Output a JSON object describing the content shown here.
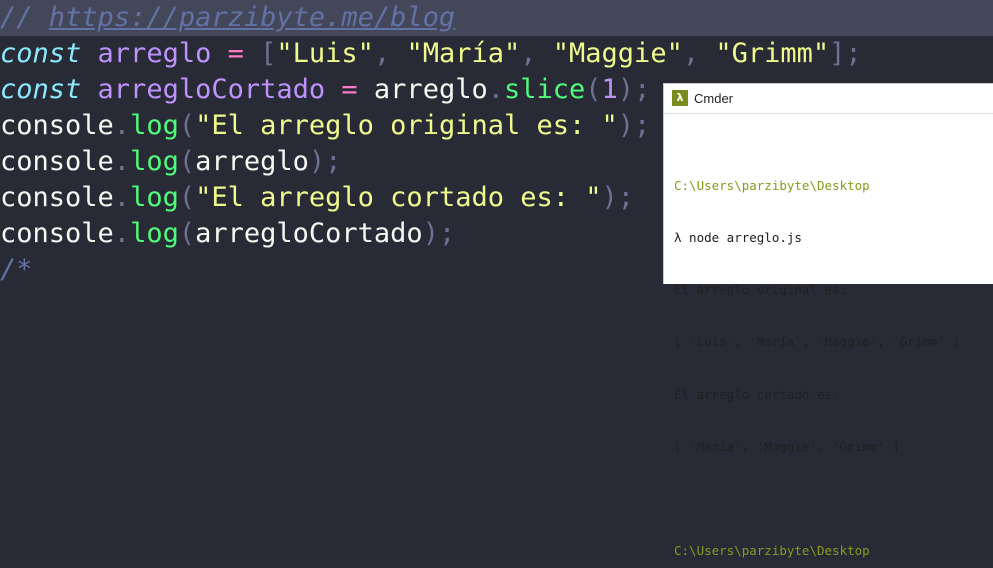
{
  "editor": {
    "comment": {
      "slashes": "// ",
      "url": "https://parzibyte.me/blog"
    },
    "line2": {
      "kw": "const",
      "name": "arreglo",
      "eq": "=",
      "open": "[",
      "s1": "\"Luis\"",
      "c1": ", ",
      "s2": "\"María\"",
      "c2": ", ",
      "s3": "\"Maggie\"",
      "c3": ", ",
      "s4": "\"Grimm\"",
      "close": "]",
      "semi": ";"
    },
    "line3": {
      "kw": "const",
      "name": "arregloCortado",
      "eq": "=",
      "obj": "arreglo",
      "dot": ".",
      "method": "slice",
      "open": "(",
      "arg": "1",
      "close": ")",
      "semi": ";"
    },
    "line4": {
      "obj": "console",
      "dot": ".",
      "method": "log",
      "open": "(",
      "str": "\"El arreglo original es: \"",
      "close": ")",
      "semi": ";"
    },
    "line5": {
      "obj": "console",
      "dot": ".",
      "method": "log",
      "open": "(",
      "arg": "arreglo",
      "close": ")",
      "semi": ";"
    },
    "line6": {
      "obj": "console",
      "dot": ".",
      "method": "log",
      "open": "(",
      "str": "\"El arreglo cortado es: \"",
      "close": ")",
      "semi": ";"
    },
    "line7": {
      "obj": "console",
      "dot": ".",
      "method": "log",
      "open": "(",
      "arg": "arregloCortado",
      "close": ")",
      "semi": ";"
    },
    "line8": {
      "comment": "/*"
    }
  },
  "cmder": {
    "title": "Cmder",
    "icon_glyph": "λ",
    "lines": [
      {
        "text": "C:\\Users\\parzibyte\\Desktop",
        "kind": "path"
      },
      {
        "text": "λ node arreglo.js",
        "kind": "cmd"
      },
      {
        "text": "El arreglo original es:",
        "kind": "out"
      },
      {
        "text": "[ 'Luis', 'María', 'Maggie', 'Grimm' ]",
        "kind": "out"
      },
      {
        "text": "El arreglo cortado es:",
        "kind": "out"
      },
      {
        "text": "[ 'María', 'Maggie', 'Grimm' ]",
        "kind": "out"
      },
      {
        "text": "",
        "kind": "out"
      },
      {
        "text": "C:\\Users\\parzibyte\\Desktop",
        "kind": "path"
      }
    ]
  },
  "colors": {
    "background": "#282a36",
    "line_highlight": "#44475a",
    "keyword": "#8be9fd",
    "variable": "#bd93f9",
    "string": "#f1fa8c",
    "function": "#50fa7b",
    "operator": "#ff79c6",
    "comment": "#6272a4",
    "terminal_path": "#8a9a1a"
  }
}
